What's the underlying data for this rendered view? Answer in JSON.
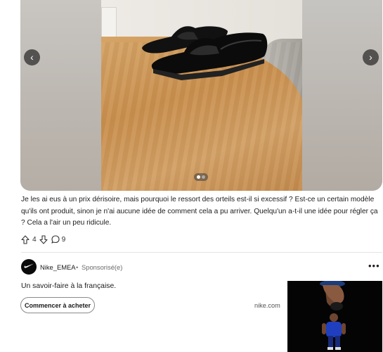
{
  "carousel": {
    "prev_label": "‹",
    "next_label": "›",
    "image_icon": "shoes-photo",
    "slide_count": 2,
    "active_slide": 1
  },
  "post": {
    "body": "Je les ai eus à un prix dérisoire, mais pourquoi le ressort des orteils est-il si excessif ? Est-ce un certain modèle qu'ils ont produit, sinon je n'ai aucune idée de comment cela a pu arriver. Quelqu'un a-t-il une idée pour régler ça ? Cela a l'air un peu ridicule.",
    "upvotes": "4",
    "comments": "9"
  },
  "ad": {
    "advertiser": "Nike_EMEA",
    "separator": "•",
    "sponsored": "Sponsorisé(e)",
    "more": "•••",
    "tagline": "Un savoir-faire à la française.",
    "cta": "Commencer à acheter",
    "domain": "nike.com",
    "avatar_icon": "nike-swoosh-icon",
    "image_icon": "athlete-ad-image"
  },
  "colors": {
    "ad_bg": "#040404",
    "text": "#1c1c1c",
    "muted": "#6a6a6a"
  }
}
